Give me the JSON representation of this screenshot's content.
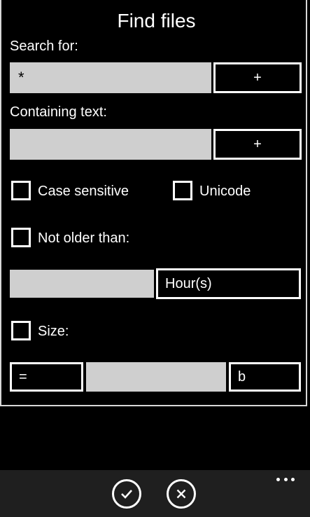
{
  "dialog": {
    "title": "Find files",
    "search_for_label": "Search for:",
    "search_for_value": "*",
    "search_add_label": "+",
    "containing_text_label": "Containing text:",
    "containing_text_value": "",
    "containing_add_label": "+",
    "case_sensitive_label": "Case sensitive",
    "case_sensitive_checked": false,
    "unicode_label": "Unicode",
    "unicode_checked": false,
    "not_older_than_label": "Not older than:",
    "not_older_than_checked": false,
    "not_older_than_value": "",
    "time_unit": "Hour(s)",
    "size_label": "Size:",
    "size_checked": false,
    "size_operator": "=",
    "size_value": "",
    "size_unit": "b"
  },
  "appbar": {
    "icons": [
      "check-icon",
      "close-icon",
      "more-icon"
    ]
  }
}
